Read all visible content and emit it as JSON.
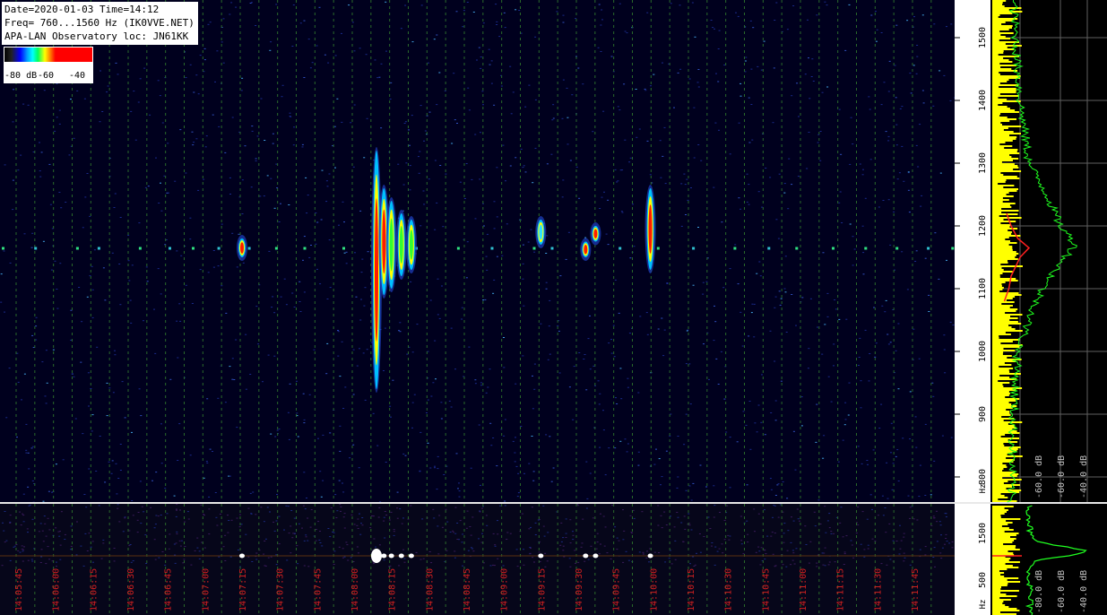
{
  "info": {
    "line1": "Date=2020-01-03 Time=14:12",
    "line2": "Freq= 760...1560 Hz (IK0VVE.NET)",
    "line3": "APA-LAN Observatory loc: JN61KK"
  },
  "scale": {
    "labels": [
      "-80 dB",
      "-60",
      "-40"
    ]
  },
  "chart_data": [
    {
      "type": "heatmap",
      "title": "Date=2020-01-03 Time=14:12",
      "y_range": [
        760,
        1560
      ],
      "y_unit": "Hz",
      "y_ticks": [
        "800",
        "900",
        "1000",
        "1100",
        "1200",
        "1300",
        "1400",
        "1500"
      ],
      "x_ticks": [
        "14:05:45",
        "14:06:00",
        "14:06:15",
        "14:06:30",
        "14:06:45",
        "14:07:00",
        "14:07:15",
        "14:07:30",
        "14:07:45",
        "14:08:00",
        "14:08:15",
        "14:08:30",
        "14:08:45",
        "14:09:00",
        "14:09:15",
        "14:09:30",
        "14:09:45",
        "14:10:00",
        "14:10:15",
        "14:10:30",
        "14:10:45",
        "14:11:00",
        "14:11:15",
        "14:11:30",
        "14:11:45"
      ],
      "carrier_hz": 1165,
      "events": [
        {
          "time": "14:07:15",
          "f_low": 1150,
          "f_high": 1180,
          "peak": "red"
        },
        {
          "time": "14:08:09",
          "f_low": 940,
          "f_high": 1320,
          "peak": "red"
        },
        {
          "time": "14:08:12",
          "f_low": 1090,
          "f_high": 1260,
          "peak": "red"
        },
        {
          "time": "14:08:15",
          "f_low": 1100,
          "f_high": 1240,
          "peak": "green"
        },
        {
          "time": "14:08:19",
          "f_low": 1120,
          "f_high": 1220,
          "peak": "green"
        },
        {
          "time": "14:08:23",
          "f_low": 1130,
          "f_high": 1210,
          "peak": "green"
        },
        {
          "time": "14:09:15",
          "f_low": 1170,
          "f_high": 1210,
          "peak": "cyan"
        },
        {
          "time": "14:09:33",
          "f_low": 1150,
          "f_high": 1175,
          "peak": "red"
        },
        {
          "time": "14:09:37",
          "f_low": 1175,
          "f_high": 1200,
          "peak": "red"
        },
        {
          "time": "14:09:59",
          "f_low": 1130,
          "f_high": 1260,
          "peak": "red"
        }
      ]
    },
    {
      "type": "line",
      "x_unit": "dB",
      "x_ticks": [
        "-60.0 dB",
        "-60.0 dB",
        "-40.0 dB"
      ],
      "y_ticks": [
        "800",
        "900",
        "1000",
        "1100",
        "1200",
        "1300",
        "1400",
        "1500"
      ],
      "y_axis_label": "Hz",
      "series": [
        {
          "color": "#ffff00",
          "level_db": -75
        },
        {
          "color": "#ff2020",
          "points": [
            [
              1080,
              -69
            ],
            [
              1100,
              -67
            ],
            [
              1120,
              -66
            ],
            [
              1150,
              -62
            ],
            [
              1165,
              -58
            ],
            [
              1180,
              -63
            ],
            [
              1200,
              -66
            ],
            [
              1220,
              -68
            ]
          ]
        },
        {
          "color": "#20ff20",
          "points": [
            [
              760,
              -74
            ],
            [
              900,
              -73
            ],
            [
              1000,
              -71
            ],
            [
              1050,
              -66
            ],
            [
              1100,
              -60
            ],
            [
              1140,
              -52
            ],
            [
              1170,
              -45
            ],
            [
              1200,
              -52
            ],
            [
              1250,
              -58
            ],
            [
              1300,
              -66
            ],
            [
              1400,
              -70
            ],
            [
              1500,
              -72
            ],
            [
              1560,
              -73
            ]
          ]
        }
      ]
    }
  ],
  "strip": {
    "y_ticks": [
      "1500",
      "500"
    ],
    "y_axis_label": "Hz",
    "x_ticks": [
      "-80.0 dB",
      "-60.0 dB",
      "-40.0 dB"
    ]
  }
}
